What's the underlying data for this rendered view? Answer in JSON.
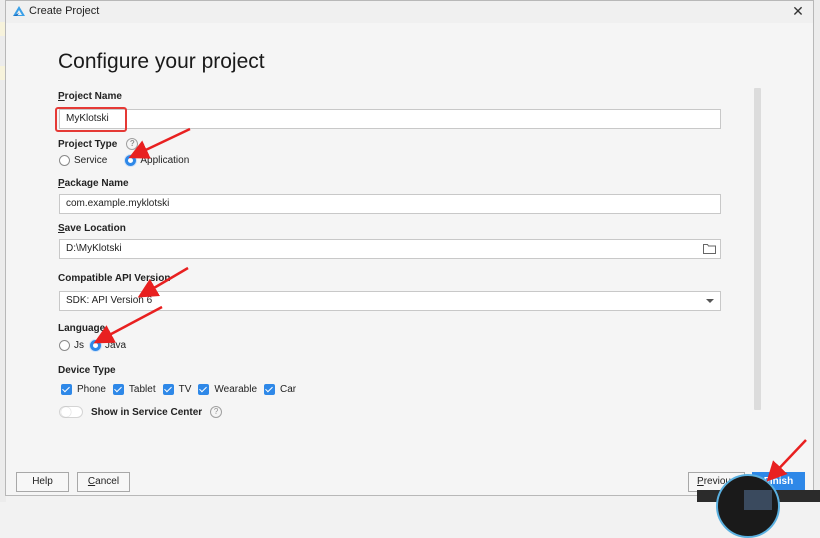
{
  "window": {
    "title": "Create Project",
    "close_label": "✕"
  },
  "page": {
    "heading": "Configure your project"
  },
  "form": {
    "project_name": {
      "label_u": "P",
      "label_rest": "roject Name",
      "value": "MyKlotski"
    },
    "project_type": {
      "label": "Project Type",
      "help": "?",
      "options": [
        {
          "label": "Service",
          "selected": false
        },
        {
          "label": "Application",
          "selected": true
        }
      ]
    },
    "package_name": {
      "label_u": "P",
      "label_rest": "ackage Name",
      "value": "com.example.myklotski"
    },
    "save_location": {
      "label_u": "S",
      "label_rest": "ave Location",
      "value": "D:\\MyKlotski"
    },
    "api_version": {
      "label": "Compatible API Version",
      "value": "SDK: API Version 6"
    },
    "language": {
      "label": "Language",
      "options": [
        {
          "label": "Js",
          "selected": false
        },
        {
          "label": "Java",
          "selected": true
        }
      ]
    },
    "device_type": {
      "label": "Device Type",
      "options": [
        {
          "label": "Phone",
          "checked": true
        },
        {
          "label": "Tablet",
          "checked": true
        },
        {
          "label": "TV",
          "checked": true
        },
        {
          "label": "Wearable",
          "checked": true
        },
        {
          "label": "Car",
          "checked": true
        }
      ]
    },
    "service_center": {
      "label": "Show in Service Center",
      "enabled": false,
      "help": "?"
    }
  },
  "footer": {
    "help": "Help",
    "cancel_u": "C",
    "cancel_rest": "ancel",
    "previous_u": "P",
    "previous_rest": "revious",
    "finish": "Finish"
  },
  "colors": {
    "accent": "#2e88e8",
    "annotation": "#e53935"
  }
}
